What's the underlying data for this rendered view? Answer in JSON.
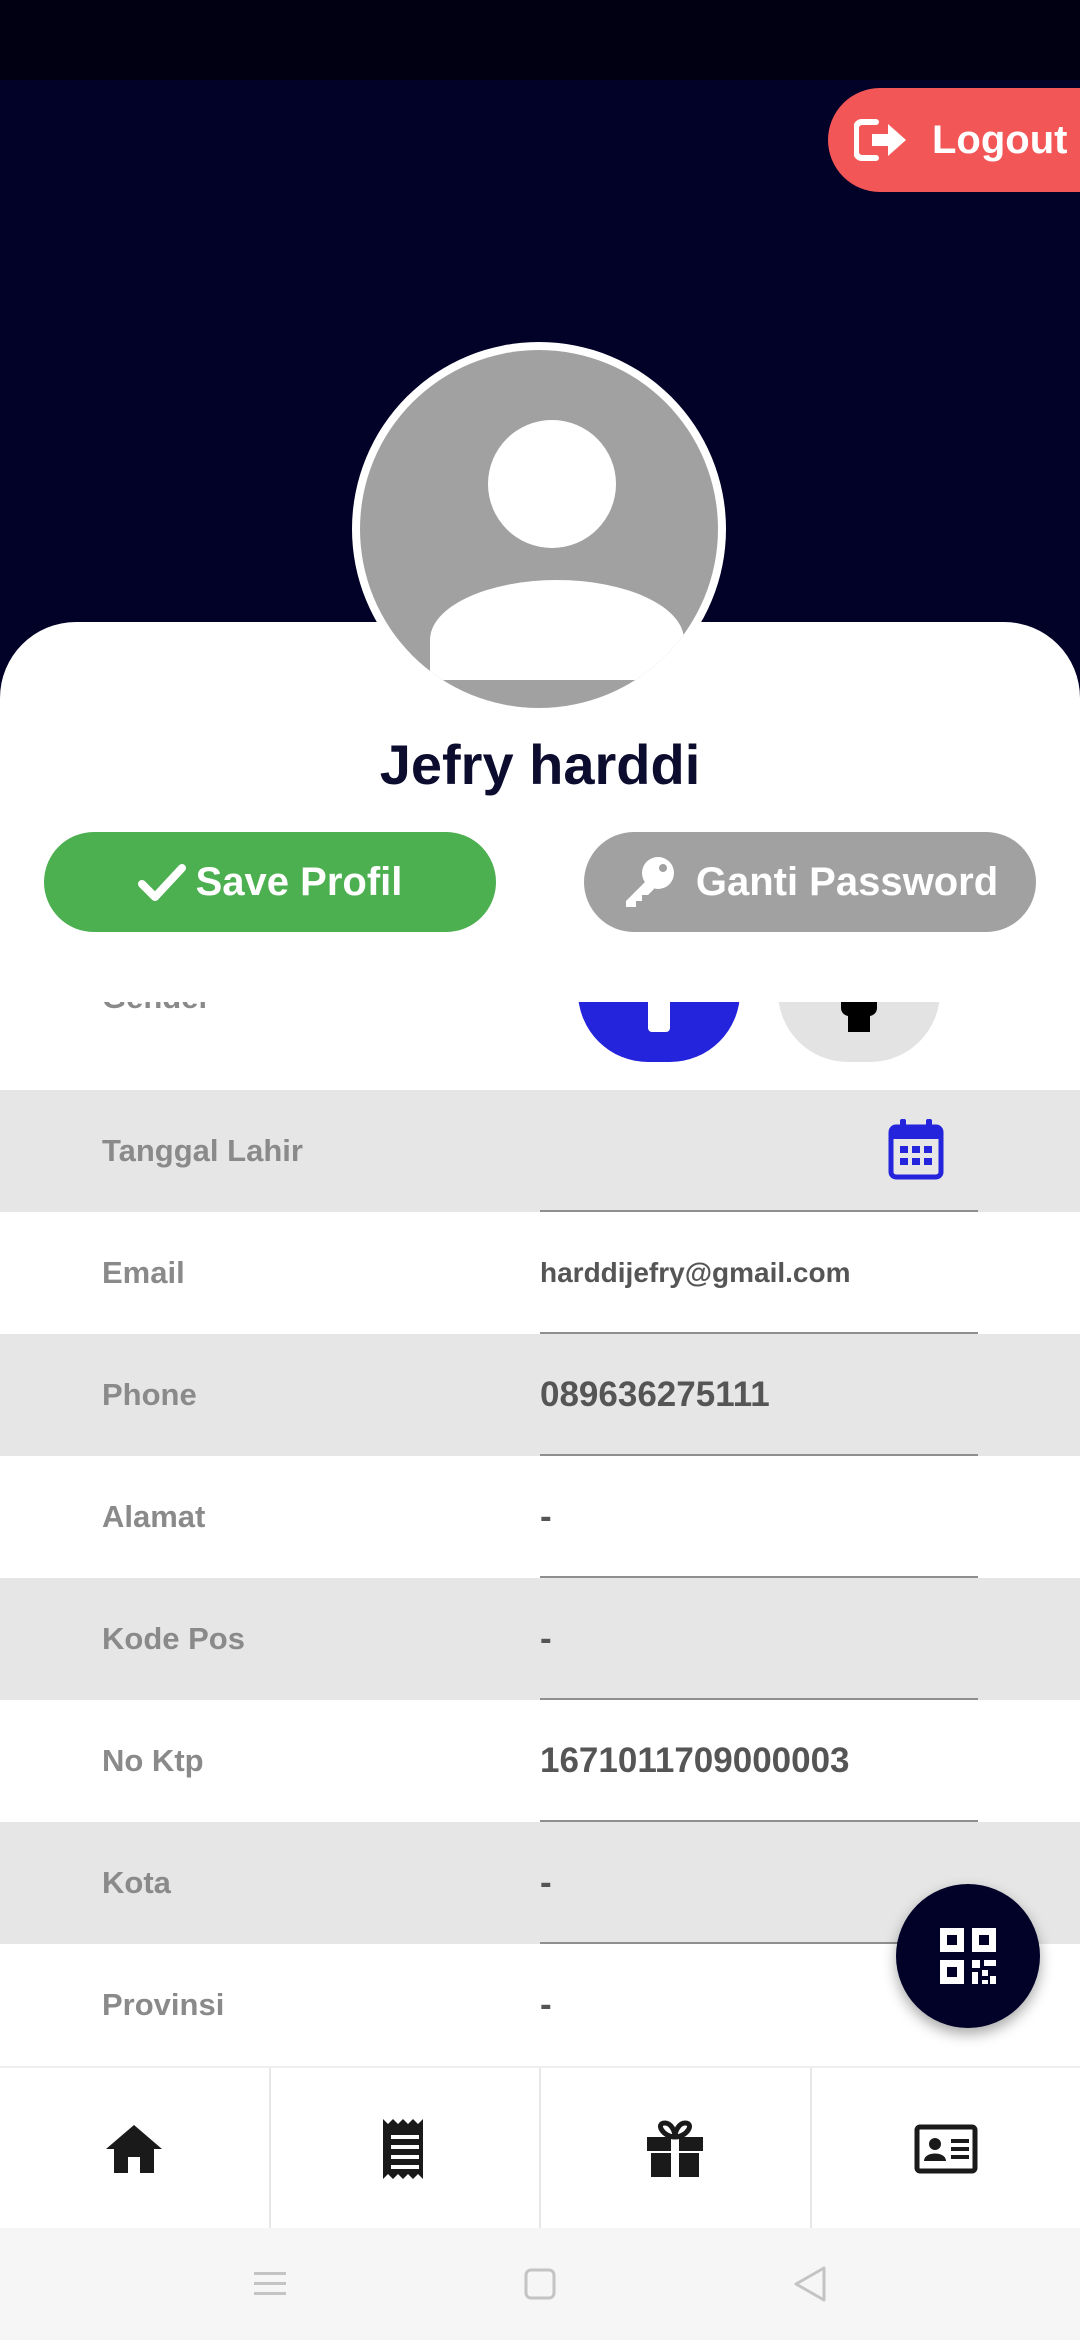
{
  "header": {
    "logout_label": "Logout"
  },
  "profile": {
    "name": "Jefry harddi",
    "save_label": "Save Profil",
    "change_password_label": "Ganti Password"
  },
  "form": {
    "gender_label": "Gender",
    "fields": [
      {
        "label": "Tanggal Lahir",
        "value": ""
      },
      {
        "label": "Email",
        "value": "harddijefry@gmail.com"
      },
      {
        "label": "Phone",
        "value": "089636275111"
      },
      {
        "label": "Alamat",
        "value": "-"
      },
      {
        "label": "Kode Pos",
        "value": "-"
      },
      {
        "label": "No Ktp",
        "value": "1671011709000003"
      },
      {
        "label": "Kota",
        "value": "-"
      },
      {
        "label": "Provinsi",
        "value": "-"
      }
    ]
  },
  "icons": {
    "logout": "logout-icon",
    "save": "check-icon",
    "password": "key-icon",
    "calendar": "calendar-icon",
    "qr": "qr-code-icon",
    "nav": [
      "home-icon",
      "receipt-icon",
      "gift-icon",
      "id-card-icon"
    ]
  },
  "colors": {
    "header": "#020128",
    "logout": "#f25656",
    "save": "#4caf50",
    "password": "#a1a1a1",
    "gender_male_selected": "#2424dc",
    "calendar": "#2424dc"
  }
}
